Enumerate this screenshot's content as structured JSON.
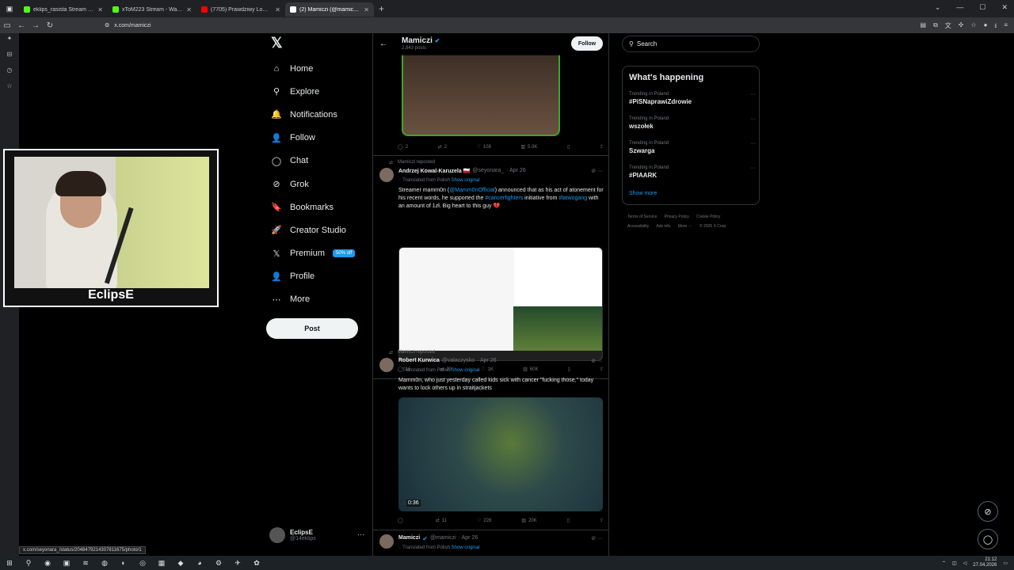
{
  "browser": {
    "tabs": [
      {
        "title": "eklips_rasista Stream - Kick Da",
        "color": "#53fc18"
      },
      {
        "title": "xToM223 Stream - Watch L",
        "color": "#53fc18"
      },
      {
        "title": "(7705) Prawdziwy Lombard - C",
        "color": "#ff0000"
      },
      {
        "title": "(2) Mamiczi (@mamiczi) / X",
        "color": "#ffffff"
      }
    ],
    "url": "x.com/mamiczi",
    "status_url": "x.com/seyonara_/status/2048479214307811675/photo/1"
  },
  "webcam": {
    "label": "EclipsE"
  },
  "xnav": {
    "logo": "𝕏",
    "items": [
      {
        "label": "Home",
        "icon": "home-icon",
        "glyph": "⌂"
      },
      {
        "label": "Explore",
        "icon": "search-icon",
        "glyph": "⚲"
      },
      {
        "label": "Notifications",
        "icon": "bell-icon",
        "glyph": "🔔"
      },
      {
        "label": "Follow",
        "icon": "add-person-icon",
        "glyph": "👤"
      },
      {
        "label": "Chat",
        "icon": "chat-icon",
        "glyph": "◯"
      },
      {
        "label": "Grok",
        "icon": "grok-icon",
        "glyph": "⊘"
      },
      {
        "label": "Bookmarks",
        "icon": "bookmark-icon",
        "glyph": "🔖"
      },
      {
        "label": "Creator Studio",
        "icon": "rocket-icon",
        "glyph": "🚀"
      },
      {
        "label": "Premium",
        "icon": "x-icon",
        "glyph": "𝕏"
      },
      {
        "label": "Profile",
        "icon": "person-icon",
        "glyph": "👤"
      },
      {
        "label": "More",
        "icon": "more-icon",
        "glyph": "⋯"
      }
    ],
    "premium_badge": "50% off",
    "post_label": "Post",
    "profile": {
      "name": "EclipsE",
      "handle": "@14eklips"
    }
  },
  "timeline": {
    "title": "Mamiczi",
    "subtitle": "2,843 posts",
    "follow_label": "Follow",
    "tweet0_actions": {
      "replies": "2",
      "reposts": "2",
      "likes": "108",
      "views": "5.9K"
    },
    "tweets": [
      {
        "repost_by": "Mamiczi reposted",
        "name": "Andrzej Kowal-Karuzela 🇵🇱",
        "handle": "@seyonara_",
        "date": "· Apr 26",
        "translated": "Translated from Polish",
        "show_original": "Show original",
        "text_a": "Streamer mamm0n (",
        "link_a": "@Mamm0nOfficial",
        "text_b": ") announced that as his act of atonement for his recent words, he supported the ",
        "link_b": "#cancerfighters",
        "text_c": " initiative from ",
        "link_c": "#latwogang",
        "text_d": " with an amount of 1zł. Big heart to this guy 💔",
        "actions": {
          "replies": "16",
          "reposts": "23",
          "likes": "1K",
          "views": "60K"
        }
      },
      {
        "repost_by": "Mamiczi reposted",
        "name": "Robert Kurwica",
        "handle": "@valaczysko",
        "date": "· Apr 26",
        "translated": "Translated from Polish",
        "show_original": "Show original",
        "text": "Mamm0n, who just yesterday called kids sick with cancer \"fucking those,\" today wants to lock others up in straitjackets",
        "video_time": "0:36",
        "actions": {
          "replies": "",
          "reposts": "11",
          "likes": "228",
          "views": "20K"
        }
      },
      {
        "name": "Mamiczi",
        "handle": "@mamiczi",
        "date": "· Apr 26",
        "translated": "Translated from Polish",
        "show_original": "Show original"
      }
    ]
  },
  "right": {
    "search_placeholder": "Search",
    "happening_title": "What's happening",
    "trends": [
      {
        "context": "Trending in Poland",
        "name": "#PiSNaprawiZdrowie"
      },
      {
        "context": "Trending in Poland",
        "name": "wszołek"
      },
      {
        "context": "Trending in Poland",
        "name": "Szwarga"
      },
      {
        "context": "Trending in Poland",
        "name": "#PIAARK"
      }
    ],
    "show_more": "Show more",
    "footer": [
      "Terms of Service",
      "Privacy Policy",
      "Cookie Policy",
      "Accessibility",
      "Ads info",
      "More ···",
      "© 2026 X Corp."
    ]
  },
  "taskbar": {
    "time": "21:12",
    "date": "27.04.2026"
  }
}
